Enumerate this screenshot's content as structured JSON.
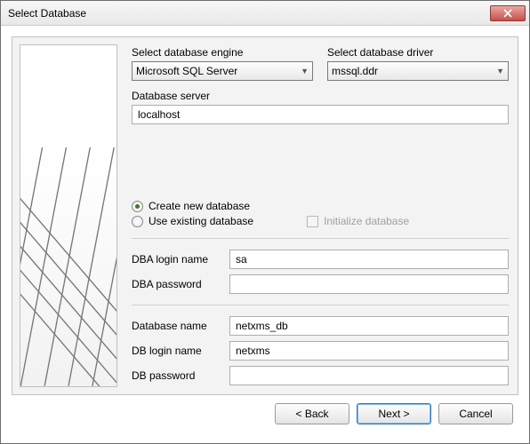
{
  "window": {
    "title": "Select Database"
  },
  "labels": {
    "engine": "Select database engine",
    "driver": "Select database driver",
    "server": "Database server",
    "create_new": "Create new database",
    "use_existing": "Use existing database",
    "init_db": "Initialize database",
    "dba_login": "DBA login name",
    "dba_password": "DBA password",
    "db_name": "Database name",
    "db_login": "DB login name",
    "db_password": "DB password"
  },
  "values": {
    "engine": "Microsoft SQL Server",
    "driver": "mssql.ddr",
    "server": "localhost",
    "dba_login": "sa",
    "dba_password": "",
    "db_name": "netxms_db",
    "db_login": "netxms",
    "db_password": ""
  },
  "radio": {
    "selected": "create_new"
  },
  "checkbox": {
    "init_db": false
  },
  "buttons": {
    "back": "< Back",
    "next": "Next >",
    "cancel": "Cancel"
  }
}
